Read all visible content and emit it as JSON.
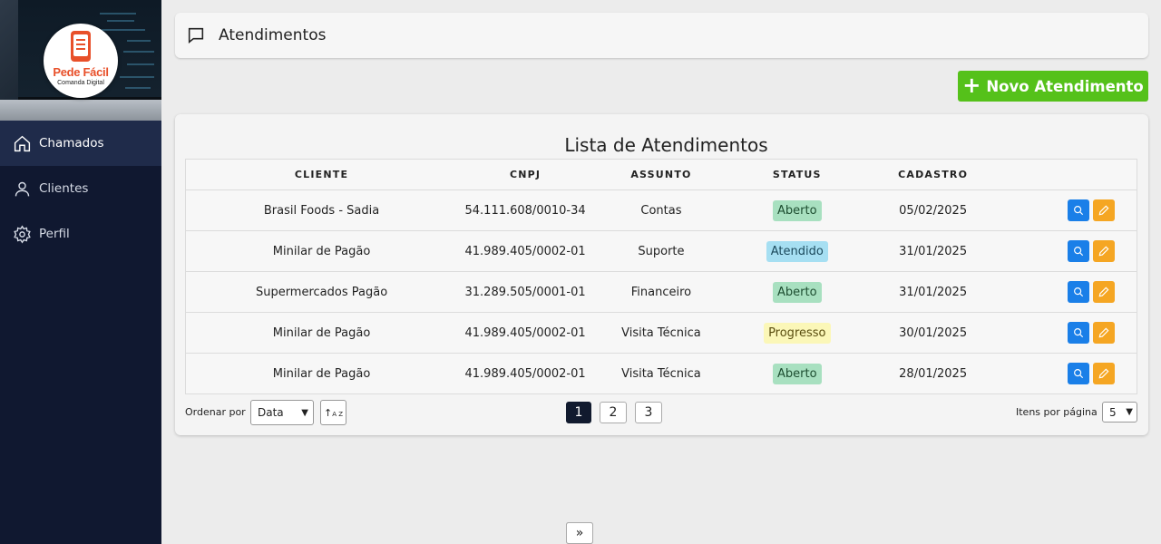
{
  "brand": {
    "name": "Pede Fácil",
    "tagline": "Comanda Digital"
  },
  "sidebar": {
    "items": [
      {
        "label": "Chamados",
        "icon": "home-icon",
        "active": true
      },
      {
        "label": "Clientes",
        "icon": "user-icon",
        "active": false
      },
      {
        "label": "Perfil",
        "icon": "gear-icon",
        "active": false
      }
    ]
  },
  "header": {
    "title": "Atendimentos",
    "icon": "chat-icon"
  },
  "actions": {
    "new_label": "Novo Atendimento"
  },
  "list": {
    "title": "Lista de Atendimentos",
    "columns": [
      "CLIENTE",
      "CNPJ",
      "ASSUNTO",
      "STATUS",
      "CADASTRO"
    ],
    "rows": [
      {
        "cliente": "Brasil Foods - Sadia",
        "cnpj": "54.111.608/0010-34",
        "assunto": "Contas",
        "status": "Aberto",
        "cadastro": "05/02/2025"
      },
      {
        "cliente": "Minilar de Pagão",
        "cnpj": "41.989.405/0002-01",
        "assunto": "Suporte",
        "status": "Atendido",
        "cadastro": "31/01/2025"
      },
      {
        "cliente": "Supermercados Pagão",
        "cnpj": "31.289.505/0001-01",
        "assunto": "Financeiro",
        "status": "Aberto",
        "cadastro": "31/01/2025"
      },
      {
        "cliente": "Minilar de Pagão",
        "cnpj": "41.989.405/0002-01",
        "assunto": "Visita Técnica",
        "status": "Progresso",
        "cadastro": "30/01/2025"
      },
      {
        "cliente": "Minilar de Pagão",
        "cnpj": "41.989.405/0002-01",
        "assunto": "Visita Técnica",
        "status": "Aberto",
        "cadastro": "28/01/2025"
      }
    ]
  },
  "status_colors": {
    "Aberto": {
      "bg": "#a8e0c0",
      "fg": "#1d4d30"
    },
    "Atendido": {
      "bg": "#a6dff2",
      "fg": "#1c4a5c"
    },
    "Progresso": {
      "bg": "#fbf7b8",
      "fg": "#5a4e10"
    }
  },
  "colors": {
    "search_button": "#1a7fe8",
    "edit_button": "#f5a623",
    "accent_green": "#55c11a",
    "sidebar": "#101830"
  },
  "footer": {
    "order_label": "Ordenar por",
    "order_value": "Data",
    "sort_icon_text": "A Z",
    "pages": [
      "1",
      "2",
      "3"
    ],
    "current_page": "1",
    "first_label": "«",
    "prev_label": "‹",
    "next_label": "›",
    "last_label": "»",
    "per_page_label": "Itens por página",
    "per_page_value": "5"
  }
}
